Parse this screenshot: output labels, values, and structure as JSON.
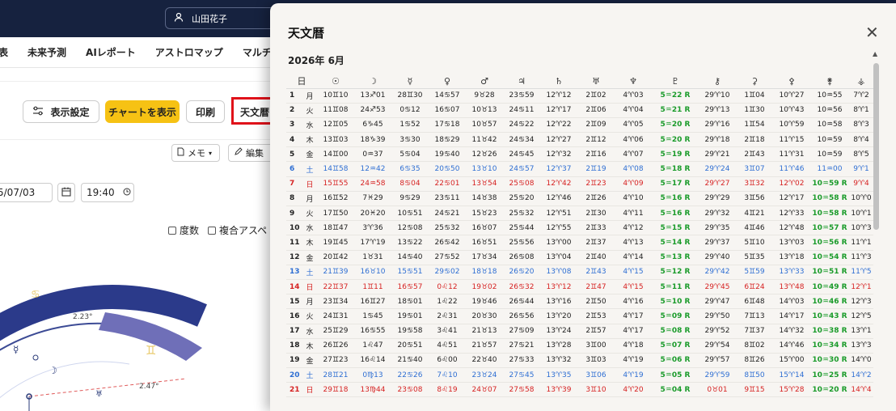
{
  "header": {
    "user_name": "山田花子"
  },
  "nav": {
    "items": [
      "年表",
      "未来予測",
      "AIレポート",
      "アストロマップ",
      "マルチチャ"
    ]
  },
  "toolbar": {
    "display_settings": "表示設定",
    "show_chart": "チャートを表示",
    "print": "印刷",
    "ephemeris": "天文暦"
  },
  "subbar": {
    "memo": "メモ",
    "edit": "編集"
  },
  "form": {
    "date": "5/07/03",
    "time": "19:40"
  },
  "options": {
    "degrees": "度数",
    "composite": "複合アスペ"
  },
  "wheel": {
    "label_1": "2.23°",
    "label_2": "2.47°"
  },
  "panel": {
    "title": "天文暦",
    "month": "2026年 6月",
    "columns": [
      "日",
      "☉",
      "☽",
      "☿",
      "♀",
      "♂",
      "♃",
      "♄",
      "♅",
      "♆",
      "♇",
      "⚷",
      "⚳",
      "⚴",
      "⚵",
      "⚶"
    ],
    "rows": [
      {
        "d": "1",
        "w": "月",
        "type": "",
        "c": [
          "10♊10",
          "13♐01",
          "28♊30",
          "14♋57",
          "9♉28",
          "23♋59",
          "12♈12",
          "2♊02",
          "4♈03",
          "5♒22 R",
          "29♈10",
          "1♊04",
          "10♈27",
          "10♒55",
          "7♈2"
        ]
      },
      {
        "d": "2",
        "w": "火",
        "type": "",
        "c": [
          "11♊08",
          "24♐53",
          "0♋12",
          "16♋07",
          "10♉13",
          "24♋11",
          "12♈17",
          "2♊06",
          "4♈04",
          "5♒21 R",
          "29♈13",
          "1♊30",
          "10♈43",
          "10♒56",
          "8♈1"
        ]
      },
      {
        "d": "3",
        "w": "水",
        "type": "",
        "c": [
          "12♊05",
          "6♑45",
          "1♋52",
          "17♋18",
          "10♉57",
          "24♋22",
          "12♈22",
          "2♊09",
          "4♈05",
          "5♒20 R",
          "29♈16",
          "1♊54",
          "10♈59",
          "10♒58",
          "8♈3"
        ]
      },
      {
        "d": "4",
        "w": "木",
        "type": "",
        "c": [
          "13♊03",
          "18♑39",
          "3♋30",
          "18♋29",
          "11♉42",
          "24♋34",
          "12♈27",
          "2♊12",
          "4♈06",
          "5♒20 R",
          "29♈18",
          "2♊18",
          "11♈15",
          "10♒59",
          "8♈4"
        ]
      },
      {
        "d": "5",
        "w": "金",
        "type": "",
        "c": [
          "14♊00",
          "0♒37",
          "5♋04",
          "19♋40",
          "12♉26",
          "24♋45",
          "12♈32",
          "2♊16",
          "4♈07",
          "5♒19 R",
          "29♈21",
          "2♊43",
          "11♈31",
          "10♒59",
          "8♈5"
        ]
      },
      {
        "d": "6",
        "w": "土",
        "type": "sat",
        "c": [
          "14♊58",
          "12♒42",
          "6♋35",
          "20♋50",
          "13♉10",
          "24♋57",
          "12♈37",
          "2♊19",
          "4♈08",
          "5♒18 R",
          "29♈24",
          "3♊07",
          "11♈46",
          "11♒00",
          "9♈1"
        ]
      },
      {
        "d": "7",
        "w": "日",
        "type": "sun",
        "c": [
          "15♊55",
          "24♒58",
          "8♋04",
          "22♋01",
          "13♉54",
          "25♋08",
          "12♈42",
          "2♊23",
          "4♈09",
          "5♒17 R",
          "29♈27",
          "3♊32",
          "12♈02",
          "10♒59 R",
          "9♈4"
        ]
      },
      {
        "d": "8",
        "w": "月",
        "type": "",
        "c": [
          "16♊52",
          "7♓29",
          "9♋29",
          "23♋11",
          "14♉38",
          "25♋20",
          "12♈46",
          "2♊26",
          "4♈10",
          "5♒16 R",
          "29♈29",
          "3♊56",
          "12♈17",
          "10♒58 R",
          "10♈0"
        ]
      },
      {
        "d": "9",
        "w": "火",
        "type": "",
        "c": [
          "17♊50",
          "20♓20",
          "10♋51",
          "24♋21",
          "15♉23",
          "25♋32",
          "12♈51",
          "2♊30",
          "4♈11",
          "5♒16 R",
          "29♈32",
          "4♊21",
          "12♈33",
          "10♒58 R",
          "10♈1"
        ]
      },
      {
        "d": "10",
        "w": "水",
        "type": "",
        "c": [
          "18♊47",
          "3♈36",
          "12♋08",
          "25♋32",
          "16♉07",
          "25♋44",
          "12♈55",
          "2♊33",
          "4♈12",
          "5♒15 R",
          "29♈35",
          "4♊46",
          "12♈48",
          "10♒57 R",
          "10♈3"
        ]
      },
      {
        "d": "11",
        "w": "木",
        "type": "",
        "c": [
          "19♊45",
          "17♈19",
          "13♋22",
          "26♋42",
          "16♉51",
          "25♋56",
          "13♈00",
          "2♊37",
          "4♈13",
          "5♒14 R",
          "29♈37",
          "5♊10",
          "13♈03",
          "10♒56 R",
          "11♈1"
        ]
      },
      {
        "d": "12",
        "w": "金",
        "type": "",
        "c": [
          "20♊42",
          "1♉31",
          "14♋40",
          "27♋52",
          "17♉34",
          "26♋08",
          "13♈04",
          "2♊40",
          "4♈14",
          "5♒13 R",
          "29♈40",
          "5♊35",
          "13♈18",
          "10♒54 R",
          "11♈3"
        ]
      },
      {
        "d": "13",
        "w": "土",
        "type": "sat",
        "c": [
          "21♊39",
          "16♉10",
          "15♋51",
          "29♋02",
          "18♉18",
          "26♋20",
          "13♈08",
          "2♊43",
          "4♈15",
          "5♒12 R",
          "29♈42",
          "5♊59",
          "13♈33",
          "10♒51 R",
          "11♈5"
        ]
      },
      {
        "d": "14",
        "w": "日",
        "type": "sun",
        "c": [
          "22♊37",
          "1♊11",
          "16♋57",
          "0♌12",
          "19♉02",
          "26♋32",
          "13♈12",
          "2♊47",
          "4♈15",
          "5♒11 R",
          "29♈45",
          "6♊24",
          "13♈48",
          "10♒49 R",
          "12♈1"
        ]
      },
      {
        "d": "15",
        "w": "月",
        "type": "",
        "c": [
          "23♊34",
          "16♊27",
          "18♋01",
          "1♌22",
          "19♉46",
          "26♋44",
          "13♈16",
          "2♊50",
          "4♈16",
          "5♒10 R",
          "29♈47",
          "6♊48",
          "14♈03",
          "10♒46 R",
          "12♈3"
        ]
      },
      {
        "d": "16",
        "w": "火",
        "type": "",
        "c": [
          "24♊31",
          "1♋45",
          "19♋01",
          "2♌31",
          "20♉30",
          "26♋56",
          "13♈20",
          "2♊53",
          "4♈17",
          "5♒09 R",
          "29♈50",
          "7♊13",
          "14♈17",
          "10♒43 R",
          "12♈5"
        ]
      },
      {
        "d": "17",
        "w": "水",
        "type": "",
        "c": [
          "25♊29",
          "16♋55",
          "19♋58",
          "3♌41",
          "21♉13",
          "27♋09",
          "13♈24",
          "2♊57",
          "4♈17",
          "5♒08 R",
          "29♈52",
          "7♊37",
          "14♈32",
          "10♒38 R",
          "13♈1"
        ]
      },
      {
        "d": "18",
        "w": "木",
        "type": "",
        "c": [
          "26♊26",
          "1♌47",
          "20♋51",
          "4♌51",
          "21♉57",
          "27♋21",
          "13♈28",
          "3♊00",
          "4♈18",
          "5♒07 R",
          "29♈54",
          "8♊02",
          "14♈46",
          "10♒34 R",
          "13♈3"
        ]
      },
      {
        "d": "19",
        "w": "金",
        "type": "",
        "c": [
          "27♊23",
          "16♌14",
          "21♋40",
          "6♌00",
          "22♉40",
          "27♋33",
          "13♈32",
          "3♊03",
          "4♈19",
          "5♒06 R",
          "29♈57",
          "8♊26",
          "15♈00",
          "10♒30 R",
          "14♈0"
        ]
      },
      {
        "d": "20",
        "w": "土",
        "type": "sat",
        "c": [
          "28♊21",
          "0♍13",
          "22♋26",
          "7♌10",
          "23♉24",
          "27♋45",
          "13♈35",
          "3♊06",
          "4♈19",
          "5♒05 R",
          "29♈59",
          "8♊50",
          "15♈14",
          "10♒25 R",
          "14♈2"
        ]
      },
      {
        "d": "21",
        "w": "日",
        "type": "sun",
        "c": [
          "29♊18",
          "13♍44",
          "23♋08",
          "8♌19",
          "24♉07",
          "27♋58",
          "13♈39",
          "3♊10",
          "4♈20",
          "5♒04 R",
          "0♉01",
          "9♊15",
          "15♈28",
          "10♒20 R",
          "14♈4"
        ]
      }
    ]
  }
}
